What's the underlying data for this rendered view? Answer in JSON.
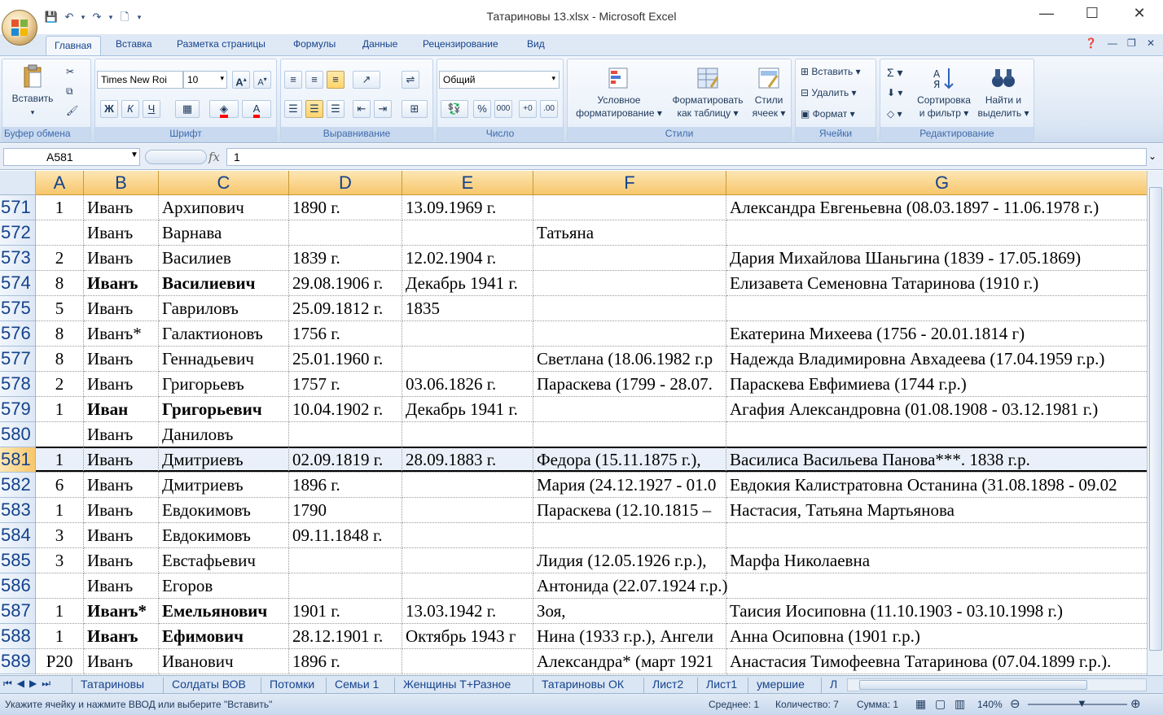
{
  "window": {
    "title": "Татариновы 13.xlsx - Microsoft Excel",
    "minimize": "—",
    "maximize": "☐",
    "close": "✕"
  },
  "ribbon_tabs": [
    "Главная",
    "Вставка",
    "Разметка страницы",
    "Формулы",
    "Данные",
    "Рецензирование",
    "Вид"
  ],
  "clipboard": {
    "paste": "Вставить",
    "label": "Буфер обмена"
  },
  "font": {
    "name": "Times New Roi",
    "size": "10",
    "label": "Шрифт",
    "bold": "Ж",
    "italic": "К",
    "underline": "Ч"
  },
  "alignment": {
    "label": "Выравнивание"
  },
  "number": {
    "format": "Общий",
    "label": "Число",
    "percent": "%",
    "thousands": "000"
  },
  "styles": {
    "cond_format": [
      "Условное",
      "форматирование ▾"
    ],
    "format_table": [
      "Форматировать",
      "как таблицу ▾"
    ],
    "cell_styles": [
      "Стили",
      "ячеек ▾"
    ],
    "label": "Стили"
  },
  "cells": {
    "insert": "Вставить ▾",
    "delete": "Удалить ▾",
    "format": "Формат ▾",
    "label": "Ячейки"
  },
  "editing": {
    "sort": [
      "Сортировка",
      "и фильтр ▾"
    ],
    "find": [
      "Найти и",
      "выделить ▾"
    ],
    "label": "Редактирование",
    "sigma": "Σ ▾"
  },
  "formula_bar": {
    "name_box": "A581",
    "fx": "fx",
    "value": "1"
  },
  "columns": [
    "A",
    "B",
    "C",
    "D",
    "E",
    "F",
    "G"
  ],
  "selected_row": "581",
  "rows": [
    {
      "num": "571",
      "a": "1",
      "b": "Иванъ",
      "c": "Архипович",
      "d": "1890 г.",
      "e": "13.09.1969 г.",
      "f": "",
      "g": "Александра Евгеньевна (08.03.1897 - 11.06.1978 г.)",
      "bold": false
    },
    {
      "num": "572",
      "a": "",
      "b": "Иванъ",
      "c": "Варнава",
      "d": "",
      "e": "",
      "f": "Татьяна",
      "g": "",
      "bold": false
    },
    {
      "num": "573",
      "a": "2",
      "b": "Иванъ",
      "c": "Василиев",
      "d": "1839 г.",
      "e": "12.02.1904 г.",
      "f": "",
      "g": "Дария Михайлова Шаньгина (1839 - 17.05.1869)",
      "bold": false
    },
    {
      "num": "574",
      "a": "8",
      "b": "Иванъ",
      "c": "Василиевич",
      "d": "29.08.1906 г.",
      "e": "Декабрь 1941 г.",
      "f": "",
      "g": "Елизавета Семеновна  Татаринова (1910 г.)",
      "bold": true
    },
    {
      "num": "575",
      "a": "5",
      "b": "Иванъ",
      "c": "Гавриловъ",
      "d": "25.09.1812 г.",
      "e": "1835",
      "f": "",
      "g": "",
      "bold": false
    },
    {
      "num": "576",
      "a": "8",
      "b": "Иванъ*",
      "c": "Галактионовъ",
      "d": "1756 г.",
      "e": "",
      "f": "",
      "g": "Екатерина Михеева (1756 -  20.01.1814 г)",
      "bold": false
    },
    {
      "num": "577",
      "a": "8",
      "b": "Иванъ",
      "c": "Геннадьевич",
      "d": "25.01.1960 г.",
      "e": "",
      "f": "Светлана (18.06.1982 г.р",
      "g": "Надежда Владимировна Авхадеева (17.04.1959 г.р.)",
      "bold": false
    },
    {
      "num": "578",
      "a": "2",
      "b": "Иванъ",
      "c": "Григорьевъ",
      "d": "1757 г.",
      "e": "03.06.1826 г.",
      "f": "Параскева (1799 - 28.07.",
      "g": "Параскева Евфимиева (1744 г.р.)",
      "bold": false
    },
    {
      "num": "579",
      "a": "1",
      "b": "Иван",
      "c": "Григорьевич",
      "d": "10.04.1902 г.",
      "e": "Декабрь 1941 г.",
      "f": "",
      "g": "Агафия Александровна (01.08.1908 - 03.12.1981 г.)",
      "bold": true
    },
    {
      "num": "580",
      "a": "",
      "b": "Иванъ",
      "c": "Даниловъ",
      "d": "",
      "e": "",
      "f": "",
      "g": "",
      "bold": false
    },
    {
      "num": "581",
      "a": "1",
      "b": "Иванъ",
      "c": "Дмитриевъ",
      "d": "02.09.1819 г.",
      "e": "28.09.1883 г.",
      "f": "Федора (15.11.1875 г.),",
      "g": " Василиса Васильева Панова***. 1838 г.р.",
      "bold": false
    },
    {
      "num": "582",
      "a": "6",
      "b": "Иванъ",
      "c": "Дмитриевъ",
      "d": "1896 г.",
      "e": "",
      "f": "Мария (24.12.1927 - 01.0",
      "g": "Евдокия Калистратовна Останина (31.08.1898 - 09.02",
      "bold": false
    },
    {
      "num": "583",
      "a": "1",
      "b": "Иванъ",
      "c": "Евдокимовъ",
      "d": "1790",
      "e": "",
      "f": "Параскева (12.10.1815 –",
      "g": "Настасия, Татьяна Мартьянова",
      "bold": false
    },
    {
      "num": "584",
      "a": "3",
      "b": "Иванъ",
      "c": "Евдокимовъ",
      "d": "09.11.1848 г.",
      "e": "",
      "f": "",
      "g": "",
      "bold": false
    },
    {
      "num": "585",
      "a": "3",
      "b": "Иванъ",
      "c": "Евстафьевич",
      "d": "",
      "e": "",
      "f": "Лидия (12.05.1926 г.р.),",
      "g": "Марфа Николаевна",
      "bold": false
    },
    {
      "num": "586",
      "a": "",
      "b": "Иванъ",
      "c": "Егоров",
      "d": "",
      "e": "",
      "f": "Антонида (22.07.1924 г.р.)",
      "g": "",
      "bold": false
    },
    {
      "num": "587",
      "a": "1",
      "b": "Иванъ*",
      "c": "Емельянович",
      "d": "1901 г.",
      "e": "13.03.1942 г.",
      "f": "Зоя,",
      "g": "Таисия Иосиповна (11.10.1903 - 03.10.1998 г.)",
      "bold": true
    },
    {
      "num": "588",
      "a": "1",
      "b": "Иванъ",
      "c": "Ефимович",
      "d": "28.12.1901 г.",
      "e": "Октябрь 1943 г",
      "f": "Нина (1933 г.р.), Ангели",
      "g": "Анна Осиповна (1901 г.р.)",
      "bold": true
    },
    {
      "num": "589",
      "a": "Р20",
      "b": "Иванъ",
      "c": "Иванович",
      "d": "1896 г.",
      "e": "",
      "f": "Александра* (март 1921",
      "g": "Анастасия Тимофеевна Татаринова (07.04.1899 г.р.).",
      "bold": false
    }
  ],
  "sheet_tabs": [
    "Татариновы",
    "Солдаты ВОВ",
    "Потомки",
    "Семьи 1",
    "Женщины Т+Разное",
    "Татариновы ОК",
    "Лист2",
    "Лист1",
    "умершие",
    "Л"
  ],
  "status": {
    "message": "Укажите ячейку и нажмите ВВОД или выберите \"Вставить\"",
    "average": "Среднее: 1",
    "count": "Количество: 7",
    "sum": "Сумма: 1",
    "zoom": "140%"
  }
}
